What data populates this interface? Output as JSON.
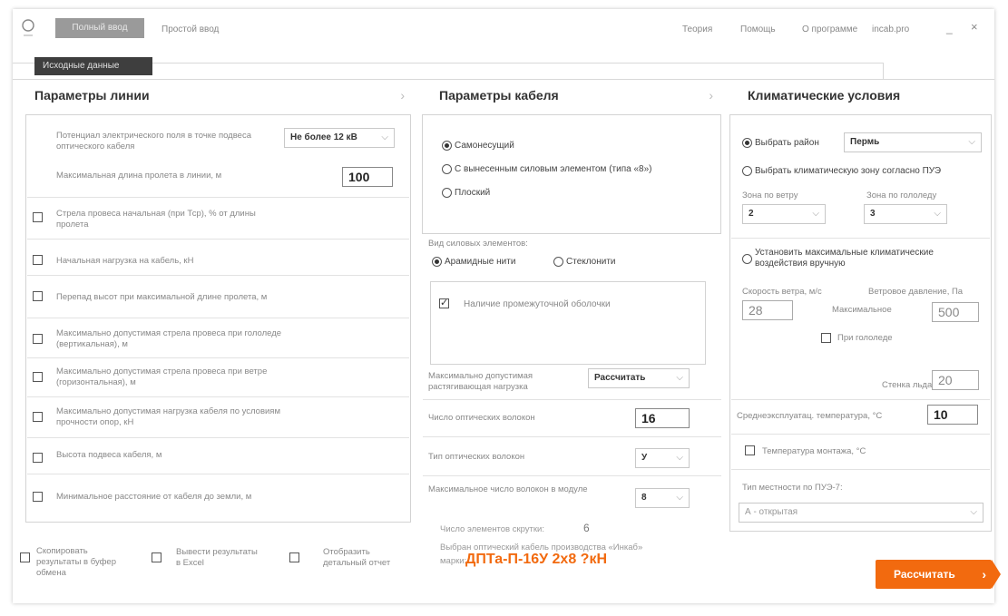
{
  "topbar": {
    "tab_full": "Полный ввод",
    "tab_simple": "Простой ввод",
    "menu": [
      "Теория",
      "Помощь",
      "О программе",
      "incab.pro"
    ],
    "minimize": "_",
    "close": "×"
  },
  "source_tab": "Исходные данные",
  "col1": {
    "title": "Параметры линии",
    "potential_label": "Потенциал электрического поля в точке подвеса оптического кабеля",
    "potential_value": "Не более 12 кВ",
    "max_span_label": "Максимальная длина пролета в линии, м",
    "max_span_value": "100",
    "checks": [
      "Стрела провеса начальная (при Тср), % от длины пролета",
      "Начальная нагрузка на кабель, кН",
      "Перепад высот при максимальной длине пролета, м",
      "Максимально допустимая стрела провеса при гололеде (вертикальная), м",
      "Максимально допустимая стрела провеса при ветре (горизонтальная), м",
      "Максимально допустимая нагрузка кабеля по условиям прочности опор, кН",
      "Высота подвеса кабеля, м",
      "Минимальное расстояние от кабеля до земли, м"
    ],
    "bottom": [
      "Скопировать результаты в буфер обмена",
      "Вывести результаты в Excel",
      "Отобразить детальный отчет"
    ]
  },
  "col2": {
    "title": "Параметры кабеля",
    "types": [
      "Самонесущий",
      "С вынесенным силовым элементом (типа «8»)",
      "Плоский"
    ],
    "strength_label": "Вид силовых элементов:",
    "strength": [
      "Арамидные нити",
      "Стеклонити"
    ],
    "intermediate": "Наличие промежуточной оболочки",
    "tension_label": "Максимально допустимая растягивающая нагрузка",
    "tension_value": "Рассчитать",
    "fibers_label": "Число оптических волокон",
    "fibers_value": "16",
    "fiber_type_label": "Тип оптических волокон",
    "fiber_type_value": "У",
    "module_label": "Максимальное число волокон в модуле",
    "module_value": "8",
    "twist_label": "Число элементов скрутки:",
    "twist_value": "6",
    "chosen_text": "Выбран оптический кабель производства «Инкаб»",
    "mark_label": "марки:",
    "mark_value": "ДПТа-П-16У 2х8 ?кН"
  },
  "col3": {
    "title": "Климатические условия",
    "choose_region": "Выбрать район",
    "region_value": "Пермь",
    "choose_zone": "Выбрать климатическую зону согласно ПУЭ",
    "wind_zone_label": "Зона по ветру",
    "wind_zone_value": "2",
    "ice_zone_label": "Зона по гололеду",
    "ice_zone_value": "3",
    "manual_label": "Установить максимальные климатические воздействия вручную",
    "wind_speed_label": "Скорость ветра, м/с",
    "wind_speed_value": "28",
    "wind_pressure_label": "Ветровое давление, Па",
    "max_label": "Максимальное",
    "max_value": "500",
    "ice_label": "При гололеде",
    "ice_wall_label": "Стенка льда, мм",
    "ice_wall_value": "20",
    "avg_temp_label": "Среднеэксплуатац. температура, °С",
    "avg_temp_value": "10",
    "install_temp_label": "Температура монтажа, °С",
    "terrain_label": "Тип местности по ПУЭ-7:",
    "terrain_value": "А - открытая"
  },
  "calculate_button": "Рассчитать"
}
